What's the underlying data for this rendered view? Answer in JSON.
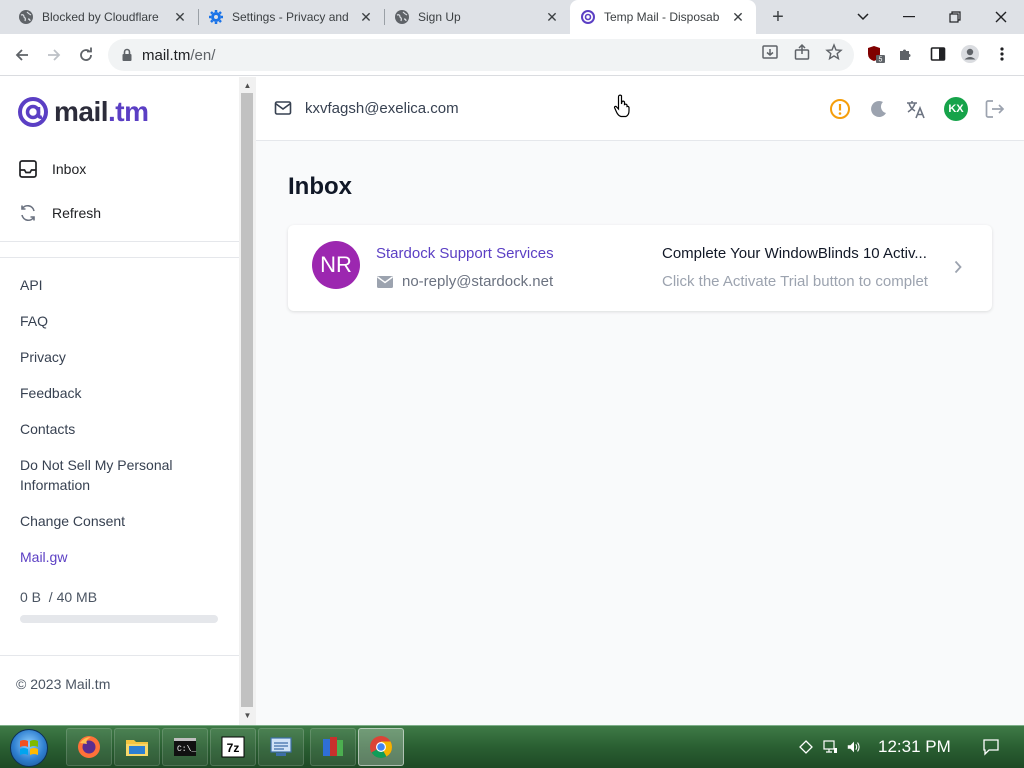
{
  "browser": {
    "tabs": [
      {
        "title": "Blocked by Cloudflare",
        "icon": "globe-icon"
      },
      {
        "title": "Settings - Privacy and",
        "icon": "gear-icon"
      },
      {
        "title": "Sign Up",
        "icon": "globe-icon"
      },
      {
        "title": "Temp Mail - Disposab",
        "icon": "mailtm-icon"
      }
    ],
    "url_host": "mail.tm",
    "url_path": "/en/"
  },
  "sidebar": {
    "logo_text": "mail",
    "logo_suffix": ".tm",
    "nav": {
      "inbox": "Inbox",
      "refresh": "Refresh"
    },
    "links": {
      "api": "API",
      "faq": "FAQ",
      "privacy": "Privacy",
      "feedback": "Feedback",
      "contacts": "Contacts",
      "do_not_sell": "Do Not Sell My Personal Information",
      "change_consent": "Change Consent",
      "mail_gw": "Mail.gw"
    },
    "quota_used": "0 B",
    "quota_total": "/ 40 MB",
    "quota_fraction": 0.0,
    "copyright": "© 2023 Mail.tm"
  },
  "header": {
    "email": "kxvfagsh@exelica.com",
    "avatar_initials": "KX"
  },
  "inbox": {
    "title": "Inbox",
    "messages": [
      {
        "avatar": "NR",
        "sender": "Stardock Support Services",
        "from": "no-reply@stardock.net",
        "subject": "Complete Your WindowBlinds 10 Activ...",
        "preview": "Click the Activate Trial button to complet"
      }
    ]
  },
  "taskbar": {
    "clock": "12:31 PM"
  },
  "colors": {
    "accent": "#5b3fc4",
    "avatar_purple": "#9c27b0",
    "avatar_green": "#16a34a",
    "warning": "#f59e0b"
  }
}
